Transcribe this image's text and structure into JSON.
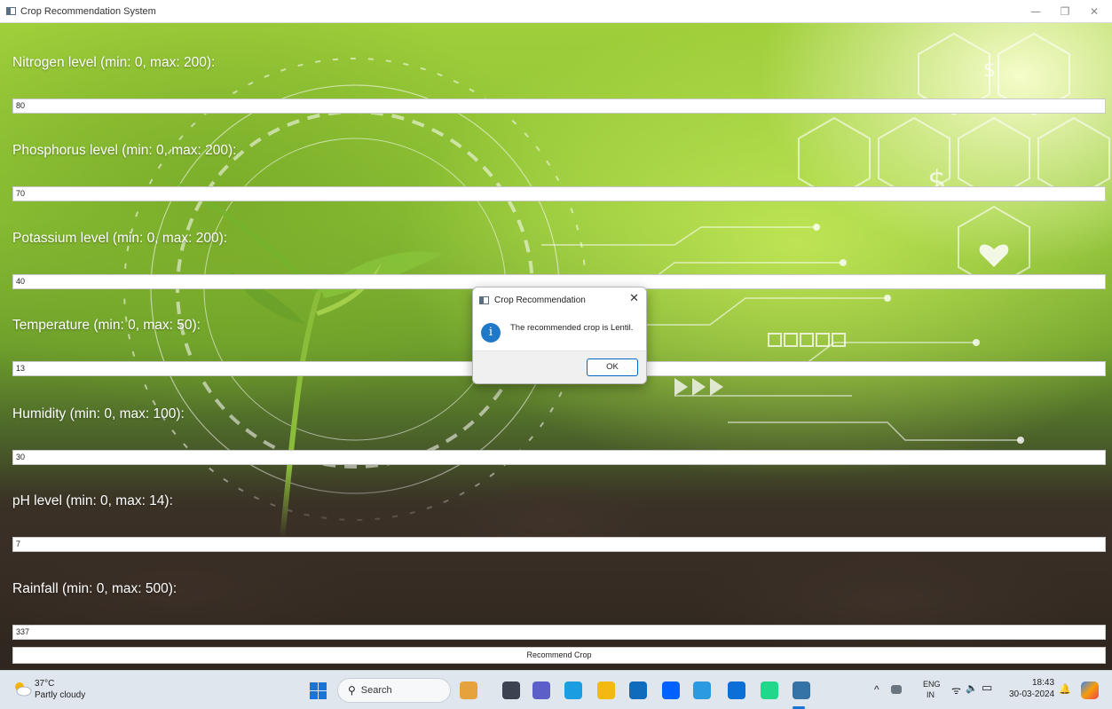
{
  "window": {
    "title": "Crop Recommendation System",
    "controls": {
      "minimize": "—",
      "restore": "❐",
      "close": "✕"
    }
  },
  "form": {
    "fields": [
      {
        "label": "Nitrogen level (min: 0, max: 200):",
        "value": "80"
      },
      {
        "label": "Phosphorus level (min: 0, max: 200):",
        "value": "70"
      },
      {
        "label": "Potassium level (min: 0, max: 200):",
        "value": "40"
      },
      {
        "label": "Temperature (min: 0, max: 50):",
        "value": "13"
      },
      {
        "label": "Humidity (min: 0, max: 100):",
        "value": "30"
      },
      {
        "label": "pH level (min: 0, max: 14):",
        "value": "7"
      },
      {
        "label": "Rainfall (min: 0, max: 500):",
        "value": "337"
      }
    ],
    "submit_label": "Recommend Crop"
  },
  "dialog": {
    "title": "Crop Recommendation",
    "close": "✕",
    "info_glyph": "i",
    "message": "The recommended crop is Lentil.",
    "ok_label": "OK"
  },
  "taskbar": {
    "weather": {
      "temp": "37°C",
      "desc": "Partly cloudy"
    },
    "search_placeholder": "Search",
    "search_glyph": "⚲",
    "apps": [
      {
        "name": "copilot-app-icon",
        "color": "#e6a23c"
      },
      {
        "name": "task-view-icon",
        "color": "#3b4350"
      },
      {
        "name": "teams-icon",
        "color": "#5b5fc7"
      },
      {
        "name": "edge-icon",
        "color": "#1b9de2"
      },
      {
        "name": "file-explorer-icon",
        "color": "#f2b90f"
      },
      {
        "name": "mail-icon",
        "color": "#0f6cbd"
      },
      {
        "name": "dropbox-icon",
        "color": "#0061fe"
      },
      {
        "name": "nudge-app-icon",
        "color": "#2b9ae0"
      },
      {
        "name": "cortana-icon",
        "color": "#0a6fd6"
      },
      {
        "name": "pycharm-icon",
        "color": "#21d789"
      },
      {
        "name": "python-app-icon",
        "color": "#3572a5"
      }
    ],
    "tray": {
      "chevron": "^",
      "language_top": "ENG",
      "language_bottom": "IN",
      "wifi": "ᯤ",
      "volume": "🔈",
      "battery": "▭",
      "time": "18:43",
      "date": "30-03-2024",
      "bell": "🔔"
    }
  }
}
